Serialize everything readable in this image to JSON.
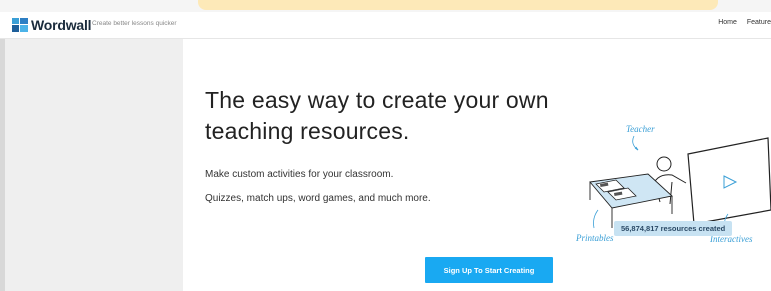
{
  "header": {
    "logo_text": "Wordwall",
    "tagline": "Create better lessons quicker",
    "nav": [
      "Home",
      "Feature"
    ]
  },
  "hero": {
    "headline": "The easy way to create your own teaching resources.",
    "subtitle_1": "Make custom activities for your classroom.",
    "subtitle_2": "Quizzes, match ups, word games, and much more.",
    "cta_label": "Sign Up To Start Creating",
    "resource_count": "56,874,817 resources created"
  },
  "illustration": {
    "label_teacher": "Teacher",
    "label_printables": "Printables",
    "label_interactives": "Interactives"
  },
  "colors": {
    "brand": "#1a2b3c",
    "cta": "#19a9f2",
    "badge_bg": "#c7e2f2",
    "illustration_blue": "#3a9fd6",
    "banner": "#fde9b8"
  }
}
